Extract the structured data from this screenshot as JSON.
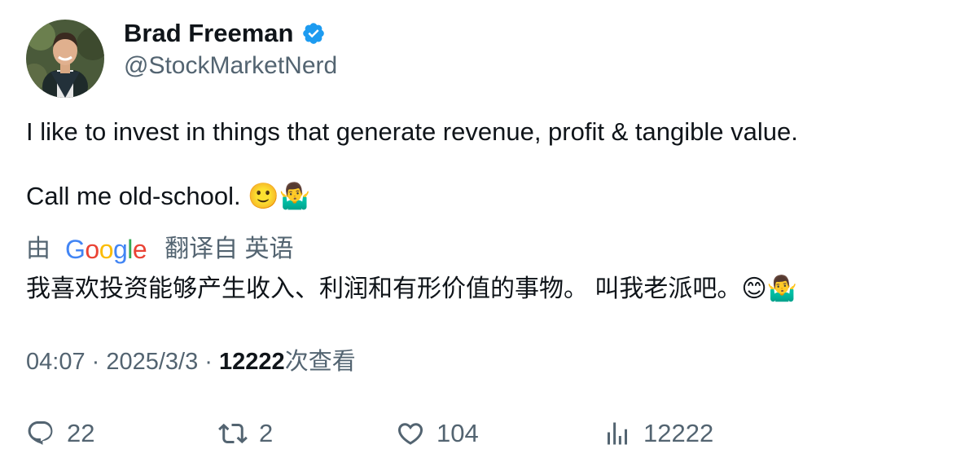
{
  "author": {
    "name": "Brad Freeman",
    "handle": "@StockMarketNerd",
    "verified_icon": "verified-badge-icon",
    "verified_color": "#1d9bf0"
  },
  "tweet": {
    "line1": "I like to invest in things that generate revenue, profit & tangible value.",
    "line2_text": "Call me old-school.",
    "line2_emoji": "🙂🤷‍♂️"
  },
  "translation": {
    "prefix": "由",
    "google_letters": [
      "G",
      "o",
      "o",
      "g",
      "l",
      "e"
    ],
    "suffix": "翻译自 英语",
    "text": "我喜欢投资能够产生收入、利润和有形价值的事物。 叫我老派吧。😊🤷‍♂️"
  },
  "meta": {
    "time": "04:07",
    "separator": " · ",
    "date": "2025/3/3",
    "views_count": "12222",
    "views_label": "次查看"
  },
  "actions": {
    "reply_count": "22",
    "retweet_count": "2",
    "like_count": "104",
    "views_count": "12222"
  },
  "colors": {
    "text_primary": "#0f1419",
    "text_secondary": "#536471",
    "google_blue": "#4285F4",
    "google_red": "#EA4335",
    "google_yellow": "#FBBC05",
    "google_green": "#34A853"
  }
}
